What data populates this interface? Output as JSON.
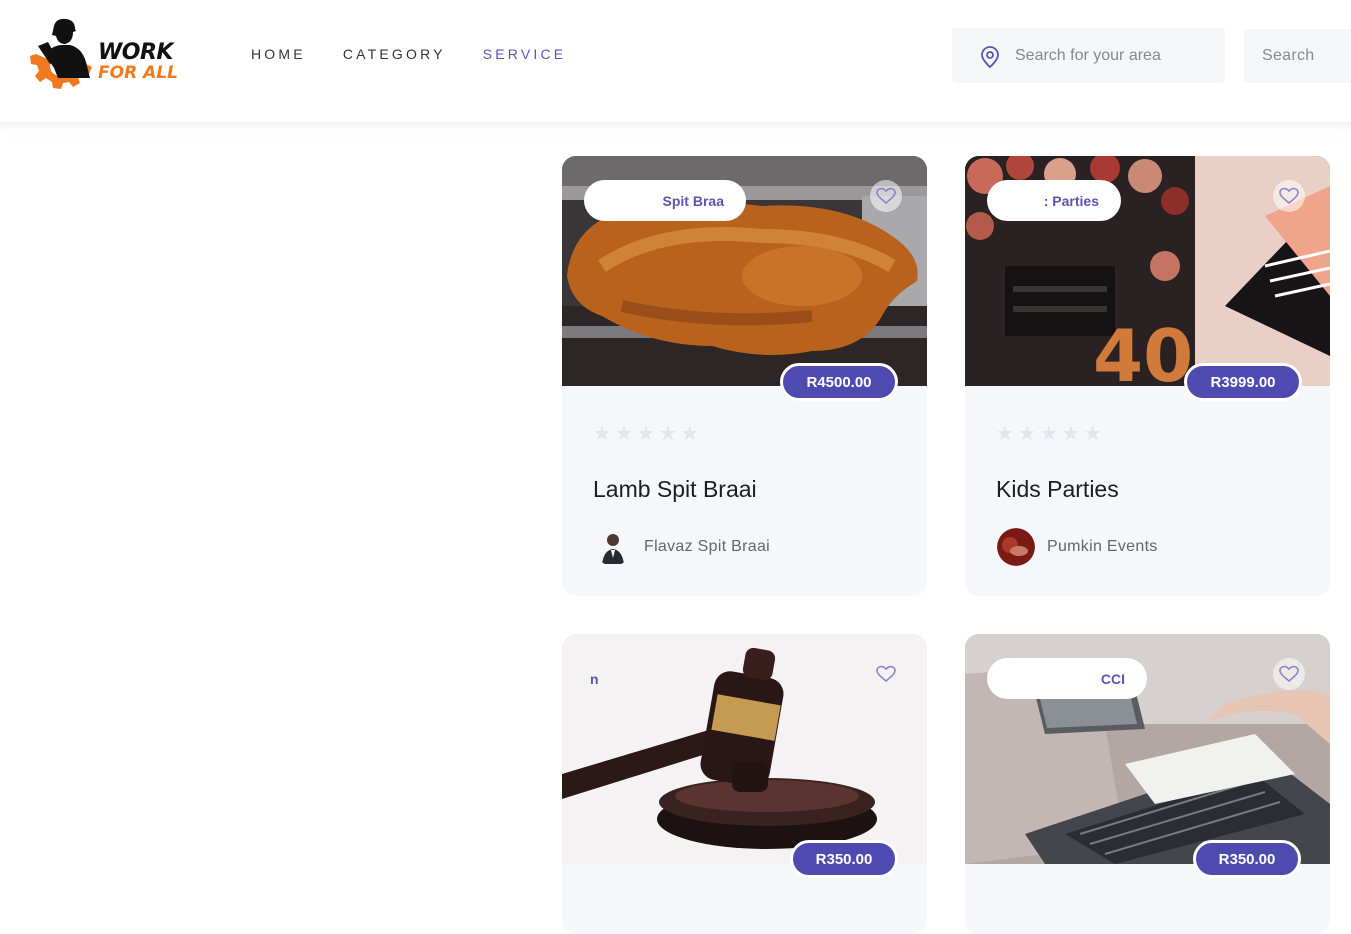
{
  "header": {
    "logo": {
      "line1": "WORK",
      "line2": "FOR ALL"
    },
    "nav": [
      {
        "label": "HOME",
        "active": false
      },
      {
        "label": "CATEGORY",
        "active": false
      },
      {
        "label": "SERVICE",
        "active": true
      }
    ],
    "search": {
      "placeholder": "Search for your area",
      "button_label": "Search"
    }
  },
  "colors": {
    "accent": "#5a55b3",
    "price_badge": "#4f4ab0",
    "logo_orange": "#f07a1d",
    "card_bg": "#f6f7fa"
  },
  "cards": [
    {
      "tag": "Spit Braa",
      "price": "R4500.00",
      "rating": 0,
      "title": "Lamb Spit Braai",
      "provider": "Flavaz Spit Braai"
    },
    {
      "tag": ": Parties",
      "price": "R3999.00",
      "rating": 0,
      "title": "Kids Parties",
      "provider": "Pumkin Events"
    },
    {
      "tag": "n",
      "price": "R350.00"
    },
    {
      "tag": "CCI",
      "price": "R350.00"
    }
  ]
}
